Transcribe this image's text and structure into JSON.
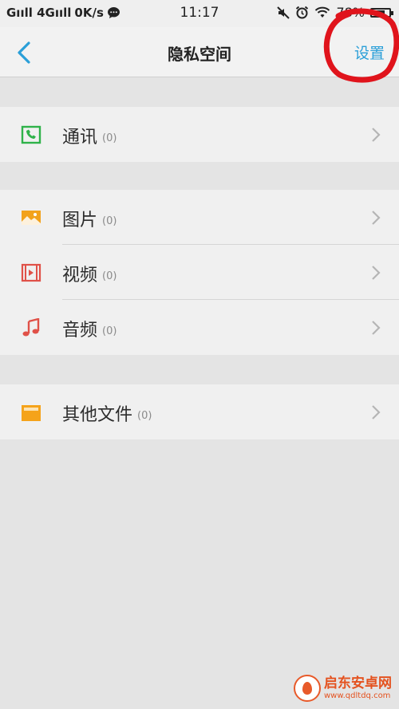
{
  "status_bar": {
    "signal_left": "Gııll 4Gııll",
    "speed": "0K/s",
    "time": "11:17",
    "battery": "78%",
    "battery_level": 0.78
  },
  "header": {
    "title": "隐私空间",
    "settings_label": "设置"
  },
  "groups": [
    {
      "items": [
        {
          "label": "通讯",
          "count": "(0)",
          "icon": "contacts-icon",
          "color": "#2fb24a"
        }
      ]
    },
    {
      "items": [
        {
          "label": "图片",
          "count": "(0)",
          "icon": "image-icon",
          "color": "#f2a21c"
        },
        {
          "label": "视频",
          "count": "(0)",
          "icon": "video-icon",
          "color": "#e05148"
        },
        {
          "label": "音频",
          "count": "(0)",
          "icon": "music-icon",
          "color": "#e05148"
        }
      ]
    },
    {
      "items": [
        {
          "label": "其他文件",
          "count": "(0)",
          "icon": "folder-icon",
          "color": "#f5a31a"
        }
      ]
    }
  ],
  "watermark": {
    "name": "启东安卓网",
    "url": "www.qdltdq.com"
  },
  "colors": {
    "accent": "#2a9fd8",
    "annotation": "#e0141c"
  }
}
